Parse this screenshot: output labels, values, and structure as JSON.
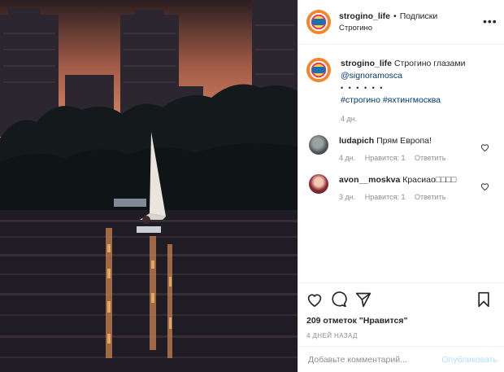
{
  "header": {
    "username": "strogino_life",
    "separator": "•",
    "follow_label": "Подписки",
    "location": "Строгино"
  },
  "caption": {
    "username": "strogino_life",
    "text": "Строгино глазами",
    "mention": "@signoramosca",
    "dots": "• • • • • •",
    "hashtags": "#строгино #яхтингмосква",
    "age": "4 дн."
  },
  "comments": [
    {
      "username": "ludapich",
      "text": "Прям Европа!",
      "age": "4 дн.",
      "likes": "Нравится: 1",
      "reply": "Ответить"
    },
    {
      "username": "avon__moskva",
      "text": "Красиао□□□□",
      "age": "3 дн.",
      "likes": "Нравится: 1",
      "reply": "Ответить"
    }
  ],
  "actions": {
    "like_icon": "heart-icon",
    "comment_icon": "comment-icon",
    "share_icon": "share-icon",
    "save_icon": "bookmark-icon",
    "likes_text": "209 отметок \"Нравится\"",
    "date": "4 ДНЕЙ НАЗАД"
  },
  "add_comment": {
    "placeholder": "Добавьте комментарий...",
    "publish_label": "Опубликовать"
  },
  "colors": {
    "link": "#00376b",
    "muted": "#8e8e8e",
    "publish_disabled": "#b2dffc"
  }
}
